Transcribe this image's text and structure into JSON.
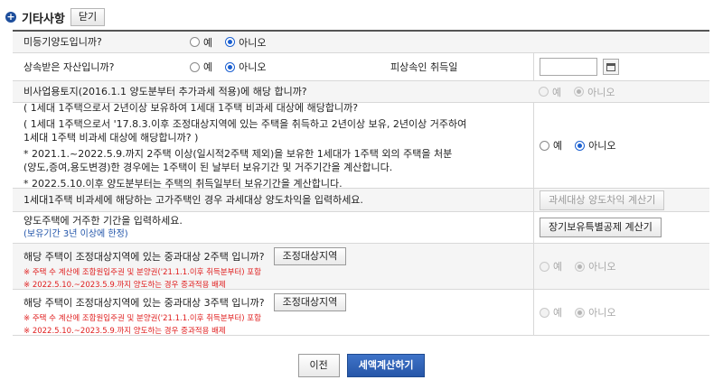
{
  "header": {
    "title": "기타사항",
    "close_label": "닫기"
  },
  "rows": {
    "r1": {
      "question": "미등기양도입니까?",
      "yes": "예",
      "no": "아니오"
    },
    "r2": {
      "question": "상속받은 자산입니까?",
      "yes": "예",
      "no": "아니오",
      "date_label": "피상속인 취득일",
      "date_value": ""
    },
    "r3": {
      "question": "비사업용토지(2016.1.1 양도분부터 추가과세 적용)에 해당 합니까?",
      "yes": "예",
      "no": "아니오"
    },
    "r4": {
      "lines": [
        "( 1세대 1주택으로서 2년이상 보유하여 1세대 1주택 비과세 대상에 해당합니까?",
        "( 1세대 1주택으로서 '17.8.3.이후 조정대상지역에 있는 주택을 취득하고 2년이상 보유, 2년이상 거주하여",
        "1세대 1주택 비과세 대상에 해당합니까? )",
        "* 2021.1.~2022.5.9.까지 2주택 이상(일시적2주택 제외)을 보유한 1세대가 1주택 외의 주택을 처분",
        "(양도,증여,용도변경)한 경우에는 1주택이 된 날부터 보유기간 및 거주기간을 계산합니다.",
        "* 2022.5.10.이후 양도분부터는 주택의 취득일부터 보유기간을 계산합니다."
      ],
      "yes": "예",
      "no": "아니오"
    },
    "r5": {
      "question": "1세대1주택 비과세에 해당하는 고가주택인 경우 과세대상 양도차익을 입력하세요.",
      "button": "과세대상 양도차익 계산기"
    },
    "r6": {
      "question": "양도주택에 거주한 기간을 입력하세요.",
      "note": "(보유기간 3년 이상에 한정)",
      "button": "장기보유특별공제 계산기"
    },
    "r7": {
      "question": "해당 주택이 조정대상지역에 있는 중과대상 2주택 입니까?",
      "button": "조정대상지역",
      "notes": [
        "※ 주택 수 계산에 조합원입주권 및 분양권('21.1.1.이후 취득분부터) 포함",
        "※ 2022.5.10.~2023.5.9.까지 양도하는 경우 중과적용 배제"
      ],
      "yes": "예",
      "no": "아니오"
    },
    "r8": {
      "question": "해당 주택이 조정대상지역에 있는 중과대상 3주택 입니까?",
      "button": "조정대상지역",
      "notes": [
        "※ 주택 수 계산에 조합원입주권 및 분양권('21.1.1.이후 취득분부터) 포함",
        "※ 2022.5.10.~2023.5.9.까지 양도하는 경우 중과적용 배제"
      ],
      "yes": "예",
      "no": "아니오"
    }
  },
  "footer": {
    "prev_label": "이전",
    "calc_label": "세액계산하기"
  },
  "colors": {
    "accent": "#2656a8",
    "note_red": "#e02020",
    "header_rule": "#555555"
  }
}
